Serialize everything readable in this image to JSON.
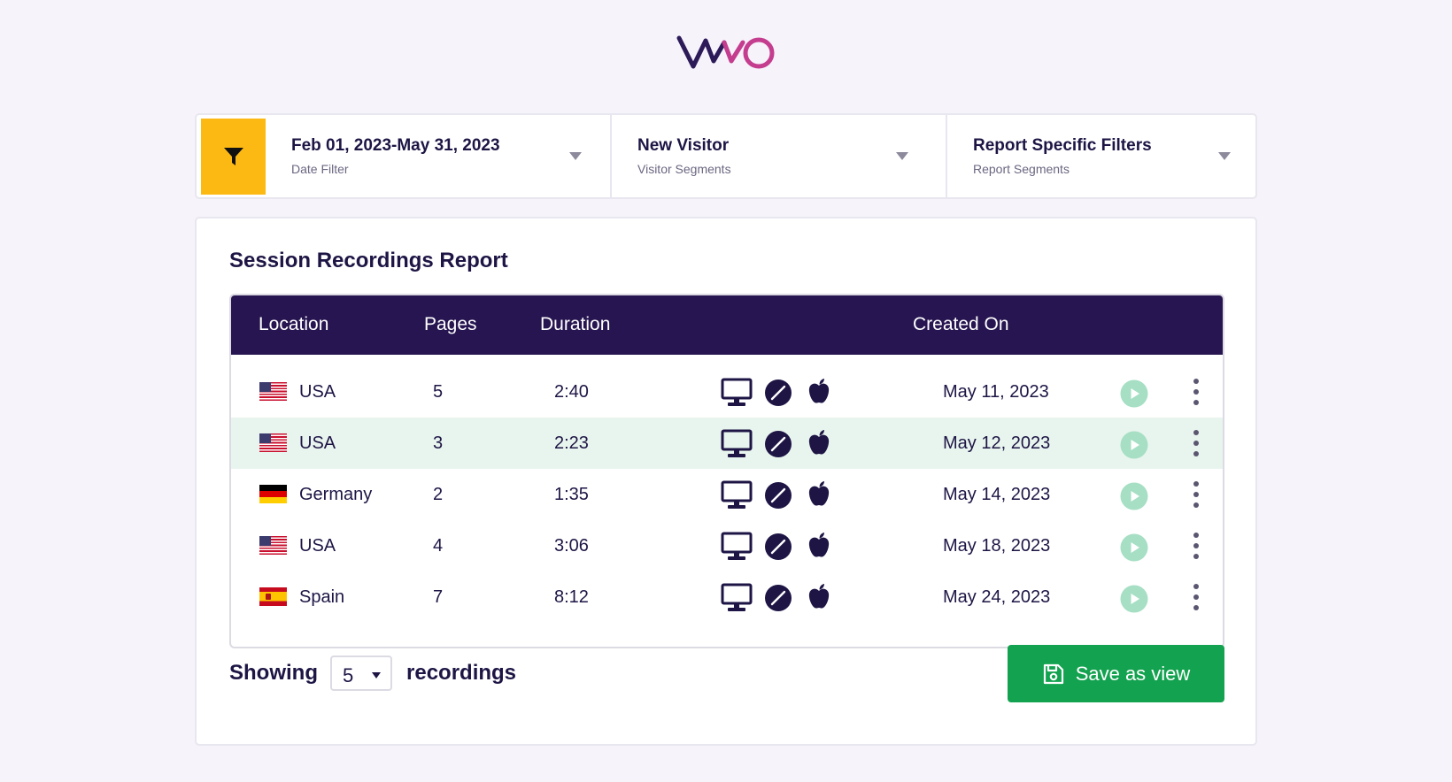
{
  "brand": {
    "logo_text": "VWO",
    "color_dark": "#2d1b59",
    "color_accent": "#c43d8e"
  },
  "filters": {
    "icon": "filter-icon",
    "accent_color": "#fdb913",
    "segments": [
      {
        "title": "Feb 01, 2023-May 31, 2023",
        "subtitle": "Date Filter"
      },
      {
        "title": "New Visitor",
        "subtitle": "Visitor Segments"
      },
      {
        "title": "Report Specific Filters",
        "subtitle": "Report Segments"
      }
    ]
  },
  "report": {
    "title": "Session Recordings Report",
    "header_color": "#261550",
    "highlight_color": "#e8f5ee",
    "columns": [
      "Location",
      "Pages",
      "Duration",
      "Created On"
    ],
    "rows": [
      {
        "flag": "us-flag",
        "location": "USA",
        "pages": "5",
        "duration": "2:40",
        "device": "desktop-icon",
        "browser": "safari-icon",
        "os": "apple-icon",
        "created": "May 11, 2023"
      },
      {
        "flag": "us-flag",
        "location": "USA",
        "pages": "3",
        "duration": "2:23",
        "device": "desktop-icon",
        "browser": "safari-icon",
        "os": "apple-icon",
        "created": "May 12, 2023"
      },
      {
        "flag": "de-flag",
        "location": "Germany",
        "pages": "2",
        "duration": "1:35",
        "device": "desktop-icon",
        "browser": "safari-icon",
        "os": "apple-icon",
        "created": "May 14, 2023"
      },
      {
        "flag": "us-flag",
        "location": "USA",
        "pages": "4",
        "duration": "3:06",
        "device": "desktop-icon",
        "browser": "safari-icon",
        "os": "apple-icon",
        "created": "May 18, 2023"
      },
      {
        "flag": "es-flag",
        "location": "Spain",
        "pages": "7",
        "duration": "8:12",
        "device": "desktop-icon",
        "browser": "safari-icon",
        "os": "apple-icon",
        "created": "May 24, 2023"
      }
    ]
  },
  "footer": {
    "showing_label": "Showing",
    "page_size": "5",
    "recordings_label": "recordings",
    "save_label": "Save as view",
    "save_color": "#13a24f"
  }
}
